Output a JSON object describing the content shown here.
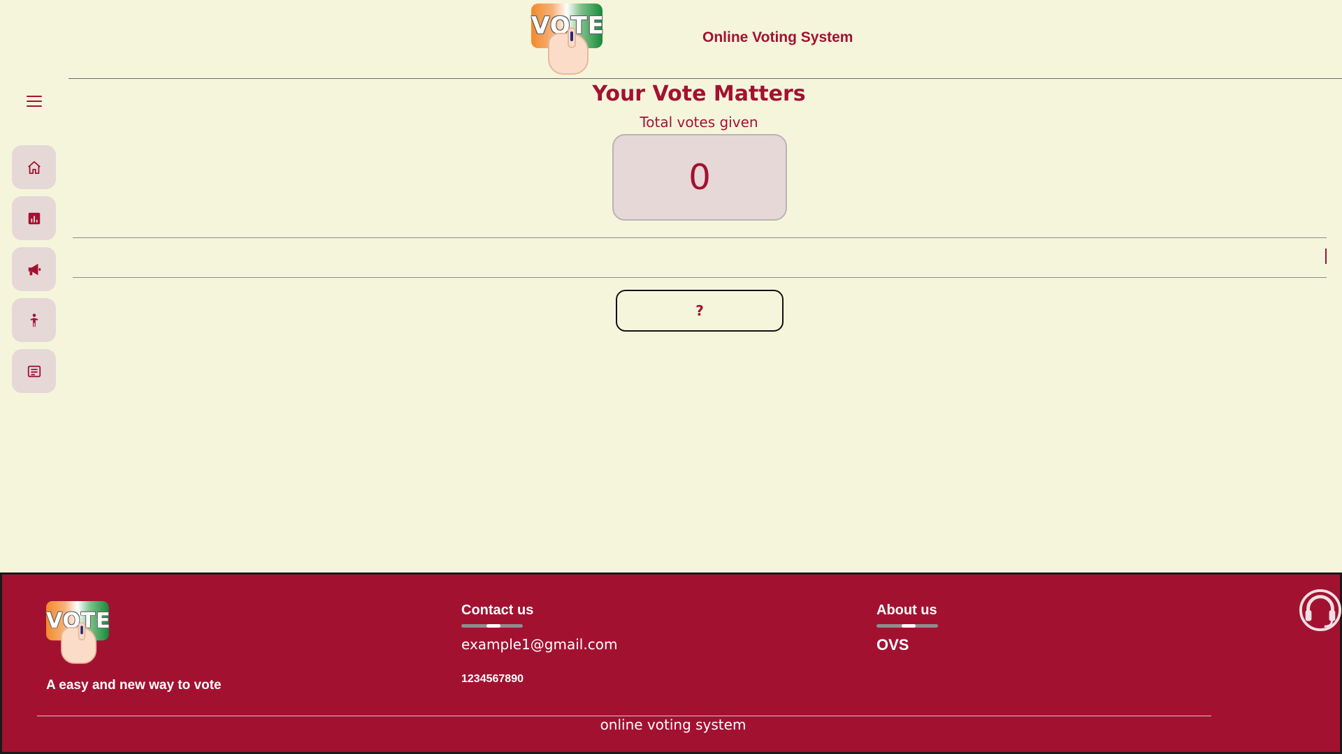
{
  "header": {
    "logo_text": "VOTE",
    "app_title": "Online Voting System"
  },
  "sidebar": {
    "menu_icon": "hamburger-menu-icon",
    "items": [
      {
        "icon": "home-icon"
      },
      {
        "icon": "bar-chart-icon"
      },
      {
        "icon": "megaphone-icon"
      },
      {
        "icon": "person-icon"
      },
      {
        "icon": "document-list-icon"
      }
    ]
  },
  "main": {
    "title": "Your Vote Matters",
    "votes_label": "Total votes given",
    "votes_count": "0",
    "help_button_label": "?"
  },
  "footer": {
    "logo_text": "VOTE",
    "tagline": "A easy and new way to vote",
    "contact": {
      "heading": "Contact us",
      "email": "example1@gmail.com",
      "phone": "1234567890"
    },
    "about": {
      "heading": "About us",
      "text": "OVS"
    },
    "copyright": "online voting system",
    "support_icon": "headset-support-icon"
  },
  "colors": {
    "background": "#f5f5dc",
    "accent": "#a31131",
    "tile": "#e6d8d6"
  }
}
